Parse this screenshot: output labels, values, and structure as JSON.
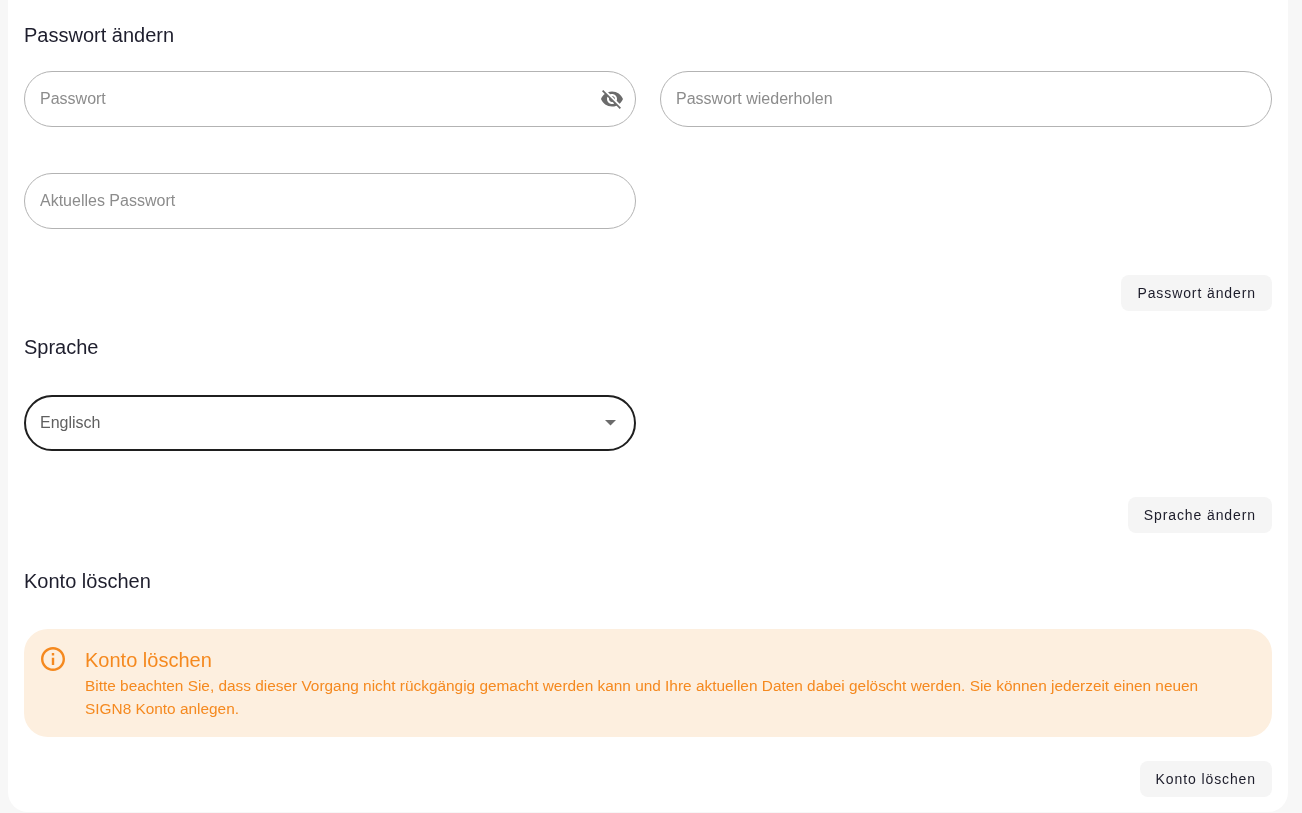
{
  "password_section": {
    "title": "Passwort ändern",
    "fields": [
      {
        "placeholder": "Passwort",
        "visibility_toggle": true
      },
      {
        "placeholder": "Passwort wiederholen",
        "visibility_toggle": false
      },
      {
        "placeholder": "Aktuelles Passwort",
        "visibility_toggle": false
      }
    ],
    "button": "Passwort ändern"
  },
  "language_section": {
    "title": "Sprache",
    "select": {
      "value": "Englisch",
      "focused": true
    },
    "button": "Sprache ändern"
  },
  "delete_section": {
    "title": "Konto löschen",
    "alert": {
      "title": "Konto löschen",
      "text": "Bitte beachten Sie, dass dieser Vorgang nicht rückgängig gemacht werden kann und Ihre aktuellen Daten dabei gelöscht werden. Sie können jederzeit einen neuen SIGN8 Konto anlegen."
    },
    "button": "Konto löschen"
  }
}
